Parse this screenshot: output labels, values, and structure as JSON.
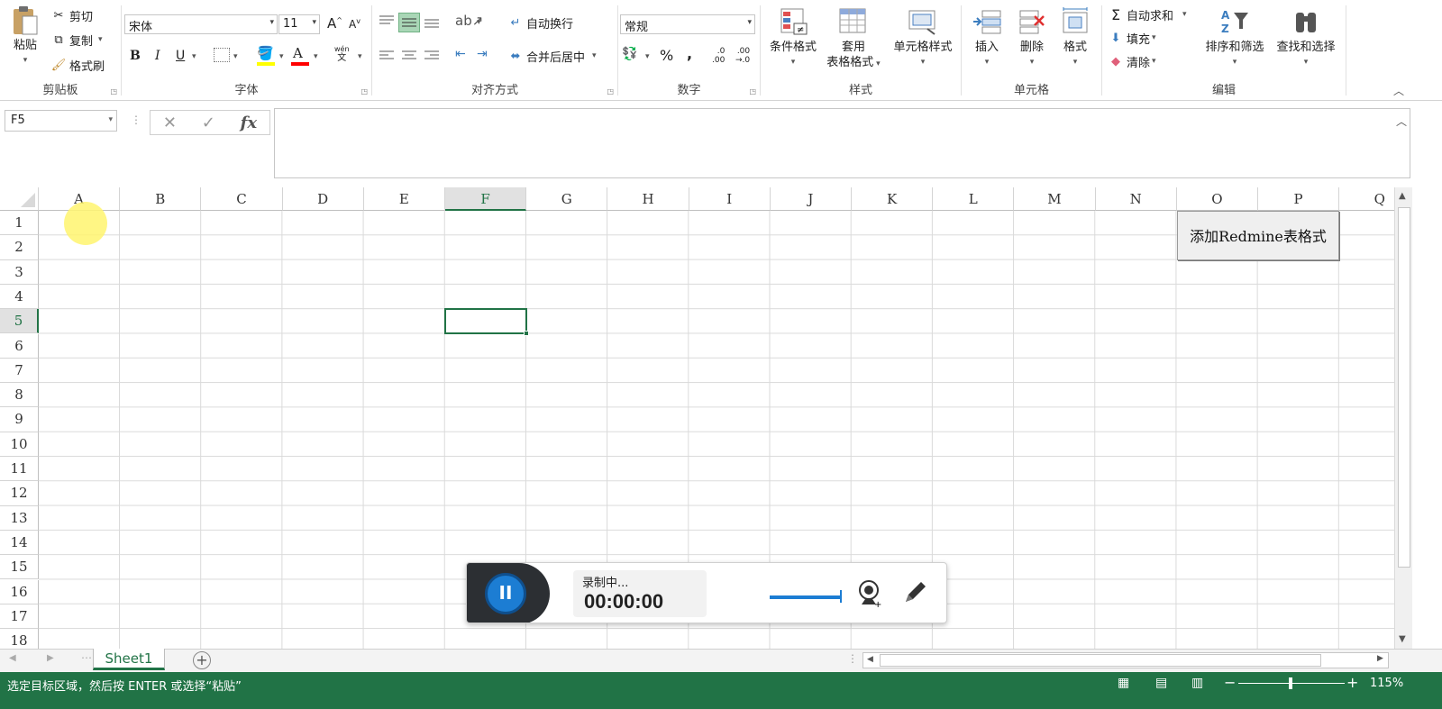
{
  "clipboard": {
    "paste_label": "粘贴",
    "cut_label": "剪切",
    "copy_label": "复制",
    "format_painter_label": "格式刷",
    "group_label": "剪贴板"
  },
  "font": {
    "name": "宋体",
    "size": "11",
    "grow_label": "A",
    "shrink_label": "A",
    "bold_label": "B",
    "italic_label": "I",
    "underline_label": "U",
    "phonetic_top": "wén",
    "phonetic_bottom": "文",
    "group_label": "字体",
    "fill_color": "#ffff00",
    "font_color": "#ff0000"
  },
  "alignment": {
    "wrap_label": "自动换行",
    "merge_label": "合并后居中",
    "group_label": "对齐方式"
  },
  "number": {
    "format": "常规",
    "percent_label": "%",
    "comma_label": ",",
    "inc_top": ".0",
    "inc_bottom": ".00",
    "dec_top": ".00",
    "dec_bottom": "→.0",
    "group_label": "数字"
  },
  "styles": {
    "conditional_label": "条件格式",
    "table_label_1": "套用",
    "table_label_2": "表格格式",
    "cell_styles_label": "单元格样式",
    "group_label": "样式"
  },
  "cells": {
    "insert_label": "插入",
    "delete_label": "删除",
    "format_label": "格式",
    "group_label": "单元格"
  },
  "editing": {
    "autosum_label": "自动求和",
    "fill_label": "填充",
    "clear_label": "清除",
    "sort_label": "排序和筛选",
    "find_label": "查找和选择",
    "group_label": "编辑"
  },
  "formula_bar": {
    "name_box": "F5",
    "fx_label": "fx",
    "cancel_symbol": "✕",
    "enter_symbol": "✓",
    "value": ""
  },
  "grid": {
    "columns": [
      "A",
      "B",
      "C",
      "D",
      "E",
      "F",
      "G",
      "H",
      "I",
      "J",
      "K",
      "L",
      "M",
      "N",
      "O",
      "P",
      "Q"
    ],
    "rows": [
      "1",
      "2",
      "3",
      "4",
      "5",
      "6",
      "7",
      "8",
      "9",
      "10",
      "11",
      "12",
      "13",
      "14",
      "15",
      "16",
      "17",
      "18"
    ],
    "selected_column": "F",
    "selected_row": "5"
  },
  "macro_button": {
    "label": "添加Redmine表格式"
  },
  "sheets": {
    "tabs": [
      "Sheet1"
    ],
    "active": "Sheet1",
    "add_symbol": "+"
  },
  "status": {
    "message": "选定目标区域，然后按 ENTER 或选择“粘贴”",
    "zoom": "115%",
    "zoom_minus": "−",
    "zoom_plus": "+"
  },
  "recorder": {
    "status_text": "录制中...",
    "time": "00:00:00",
    "pause_symbol": "II"
  },
  "colors": {
    "accent": "#217346",
    "recorder_blue": "#1c7dd3"
  }
}
